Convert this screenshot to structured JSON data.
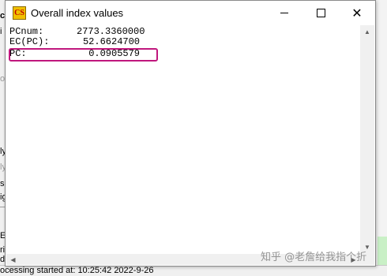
{
  "background_app": {
    "left_fragments": [
      "ct",
      "i",
      "o",
      "ly",
      "ly",
      "si",
      "ig",
      "E",
      "ri",
      "d"
    ],
    "status_text": "ocessing started at: 10:25:42 2022-9-26"
  },
  "dialog": {
    "icon_text": "CS",
    "title": "Overall index values",
    "controls": {
      "minimize": "minimize",
      "maximize": "maximize",
      "close": "✕"
    },
    "lines": [
      {
        "label": "PCnum:",
        "value": "2773.3360000"
      },
      {
        "label": "EC(PC):",
        "value": "52.6624700"
      },
      {
        "label": "PC:",
        "value": "0.0905579"
      }
    ],
    "highlighted_line_index": 2,
    "highlight_color": "#c0177d"
  },
  "watermark": "知乎 @老詹给我指个折"
}
